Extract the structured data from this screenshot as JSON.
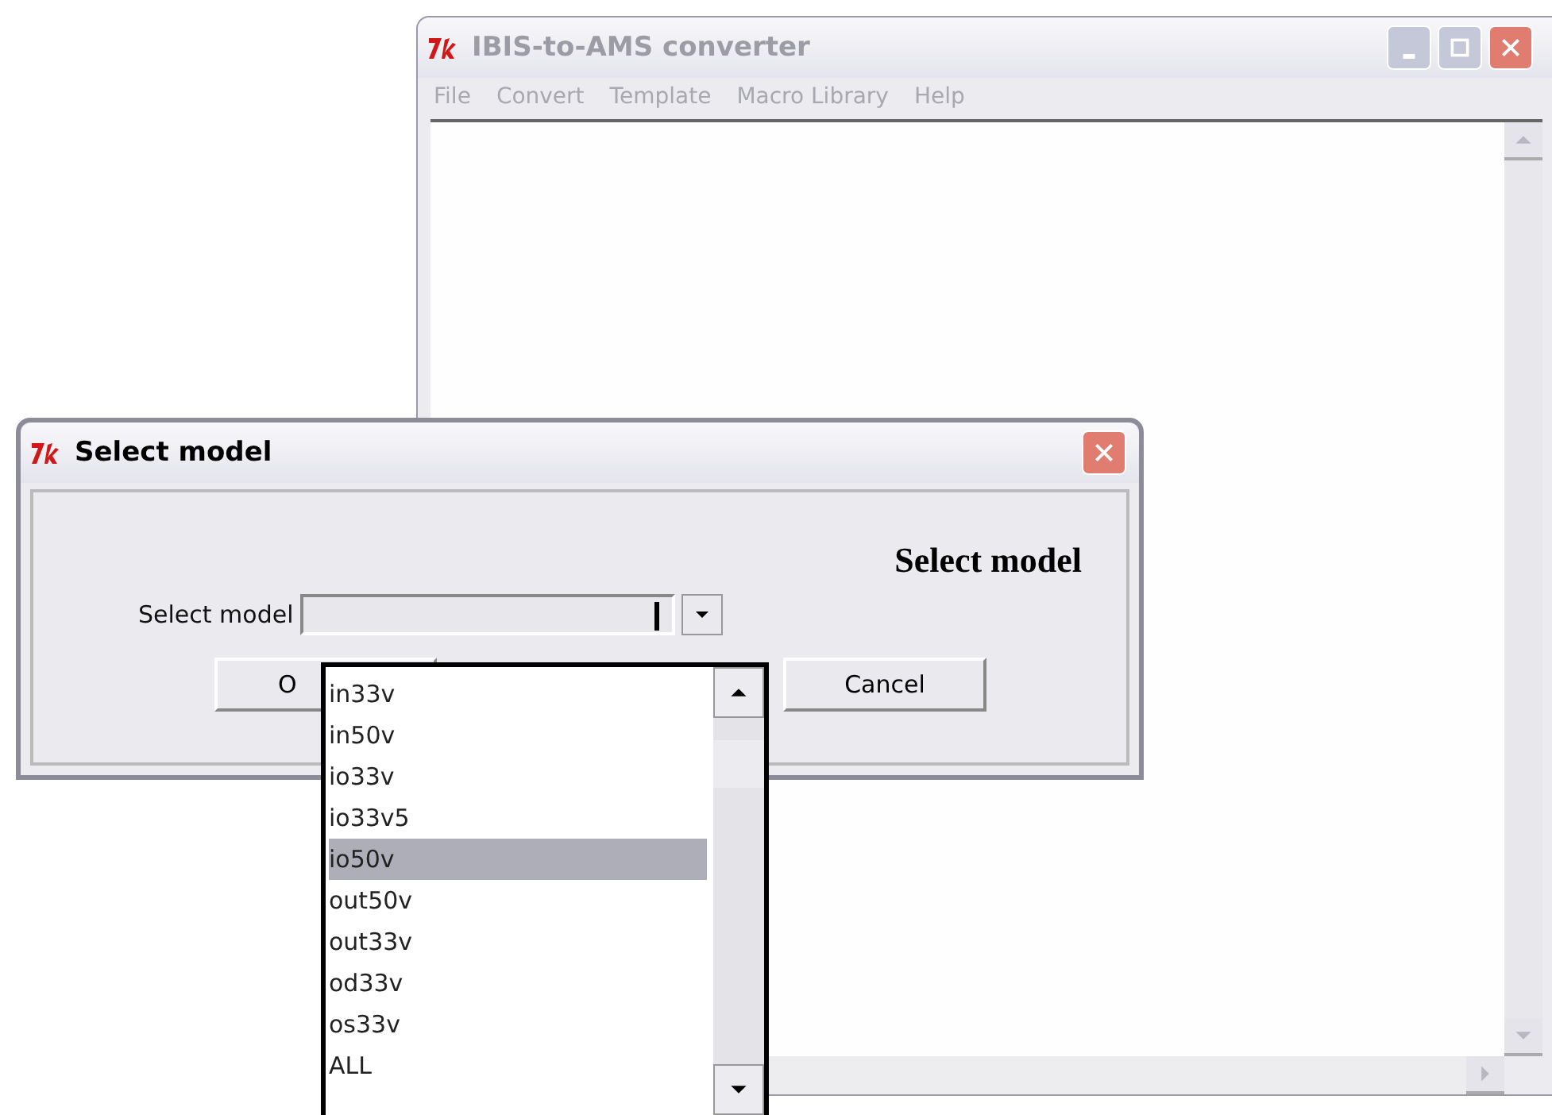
{
  "main_window": {
    "title": "IBIS-to-AMS converter",
    "active": false,
    "menu": [
      "File",
      "Convert",
      "Template",
      "Macro Library",
      "Help"
    ]
  },
  "dialog": {
    "title": "Select model",
    "heading": "Select model",
    "field_label": "Select model",
    "buttons": [
      {
        "label": "O"
      },
      {
        "label": "Cancel"
      }
    ],
    "dropdown": {
      "open": true,
      "items": [
        {
          "label": "in33v",
          "selected": false
        },
        {
          "label": "in50v",
          "selected": false
        },
        {
          "label": "io33v",
          "selected": false
        },
        {
          "label": "io33v5",
          "selected": false
        },
        {
          "label": "io50v",
          "selected": true
        },
        {
          "label": "out50v",
          "selected": false
        },
        {
          "label": "out33v",
          "selected": false
        },
        {
          "label": "od33v",
          "selected": false
        },
        {
          "label": "os33v",
          "selected": false
        },
        {
          "label": "ALL",
          "selected": false
        }
      ]
    }
  }
}
